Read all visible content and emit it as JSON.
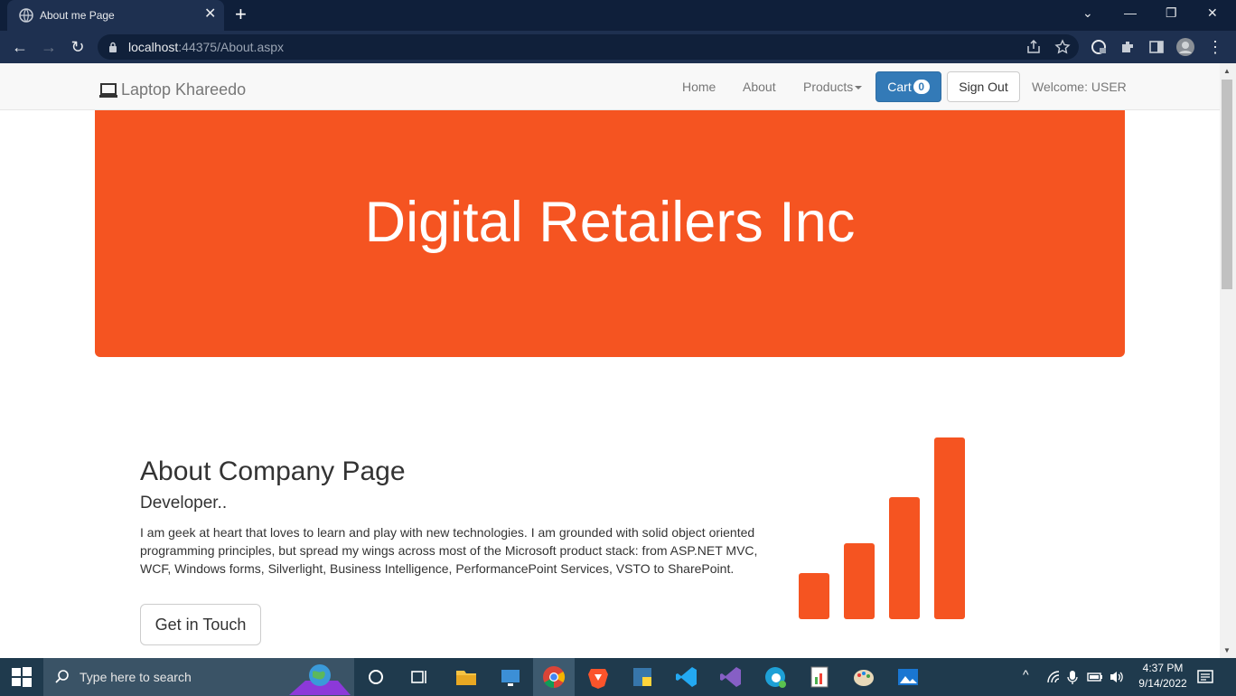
{
  "browser": {
    "tab_title": "About me Page",
    "url_host": "localhost",
    "url_rest": ":44375/About.aspx"
  },
  "navbar": {
    "brand": "Laptop Khareedo",
    "links": [
      "Home",
      "About",
      "Products"
    ],
    "cart_label": "Cart",
    "cart_count": "0",
    "signout_label": "Sign Out",
    "welcome": "Welcome: USER"
  },
  "hero": {
    "title": "Digital Retailers Inc",
    "color": "#f55421"
  },
  "about": {
    "title": "About Company Page",
    "subtitle": "Developer..",
    "text": "I am geek at heart that loves to learn and play with new technologies. I am grounded with solid object oriented programming principles, but spread my wings across most of the Microsoft product stack: from ASP.NET MVC, WCF, Windows forms, Silverlight, Business Intelligence, PerformancePoint Services, VSTO to SharePoint.",
    "button": "Get in Touch",
    "graphic": "bar-chart-icon"
  },
  "taskbar": {
    "search_placeholder": "Type here to search",
    "time": "4:37 PM",
    "date": "9/14/2022"
  },
  "colors": {
    "accent": "#f55421",
    "primary_button": "#337ab7",
    "browser_frame": "#0f1f3a",
    "taskbar": "#1f3a4d"
  }
}
